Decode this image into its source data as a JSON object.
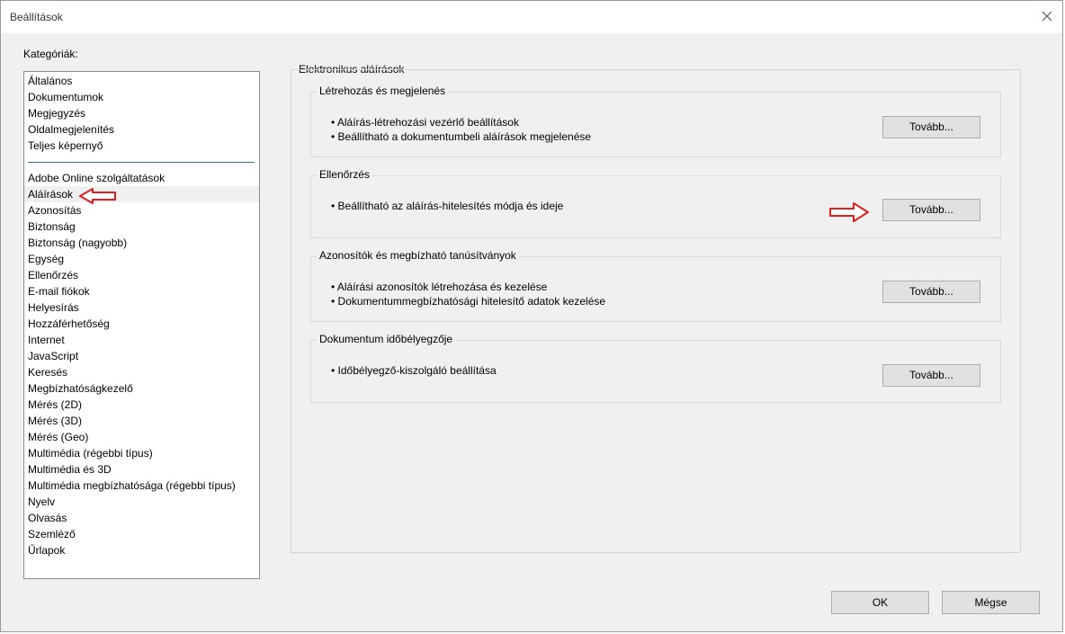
{
  "window": {
    "title": "Beállítások"
  },
  "categories": {
    "label": "Kategóriák:",
    "group1": [
      "Általános",
      "Dokumentumok",
      "Megjegyzés",
      "Oldalmegjelenítés",
      "Teljes képernyő"
    ],
    "group2": [
      "Adobe Online szolgáltatások",
      "Aláírások",
      "Azonosítás",
      "Biztonság",
      "Biztonság (nagyobb)",
      "Egység",
      "Ellenőrzés",
      "E-mail fiókok",
      "Helyesírás",
      "Hozzáférhetőség",
      "Internet",
      "JavaScript",
      "Keresés",
      "Megbízhatóságkezelő",
      "Mérés (2D)",
      "Mérés (3D)",
      "Mérés (Geo)",
      "Multimédia (régebbi típus)",
      "Multimédia és 3D",
      "Multimédia megbízhatósága (régebbi típus)",
      "Nyelv",
      "Olvasás",
      "Szemléző",
      "Űrlapok"
    ],
    "selected": "Aláírások"
  },
  "main": {
    "title": "Elektronikus aláírások",
    "groups": [
      {
        "title": "Létrehozás és megjelenés",
        "bullets": [
          "• Aláírás-létrehozási vezérlő beállítások",
          "• Beállítható a dokumentumbeli aláírások megjelenése"
        ],
        "button": "Tovább..."
      },
      {
        "title": "Ellenőrzés",
        "bullets": [
          "• Beállítható az aláírás-hitelesítés módja és ideje"
        ],
        "button": "Tovább..."
      },
      {
        "title": "Azonosítók és megbízható tanúsítványok",
        "bullets": [
          "• Aláírási azonosítók létrehozása és kezelése",
          "• Dokumentummegbízhatósági hitelesítő adatok kezelése"
        ],
        "button": "Tovább..."
      },
      {
        "title": "Dokumentum időbélyegzője",
        "bullets": [
          "• Időbélyegző-kiszolgáló beállítása"
        ],
        "button": "Tovább..."
      }
    ]
  },
  "footer": {
    "ok": "OK",
    "cancel": "Mégse"
  },
  "colors": {
    "annotation_arrow": "#e02020",
    "separator": "#2f7a87"
  }
}
